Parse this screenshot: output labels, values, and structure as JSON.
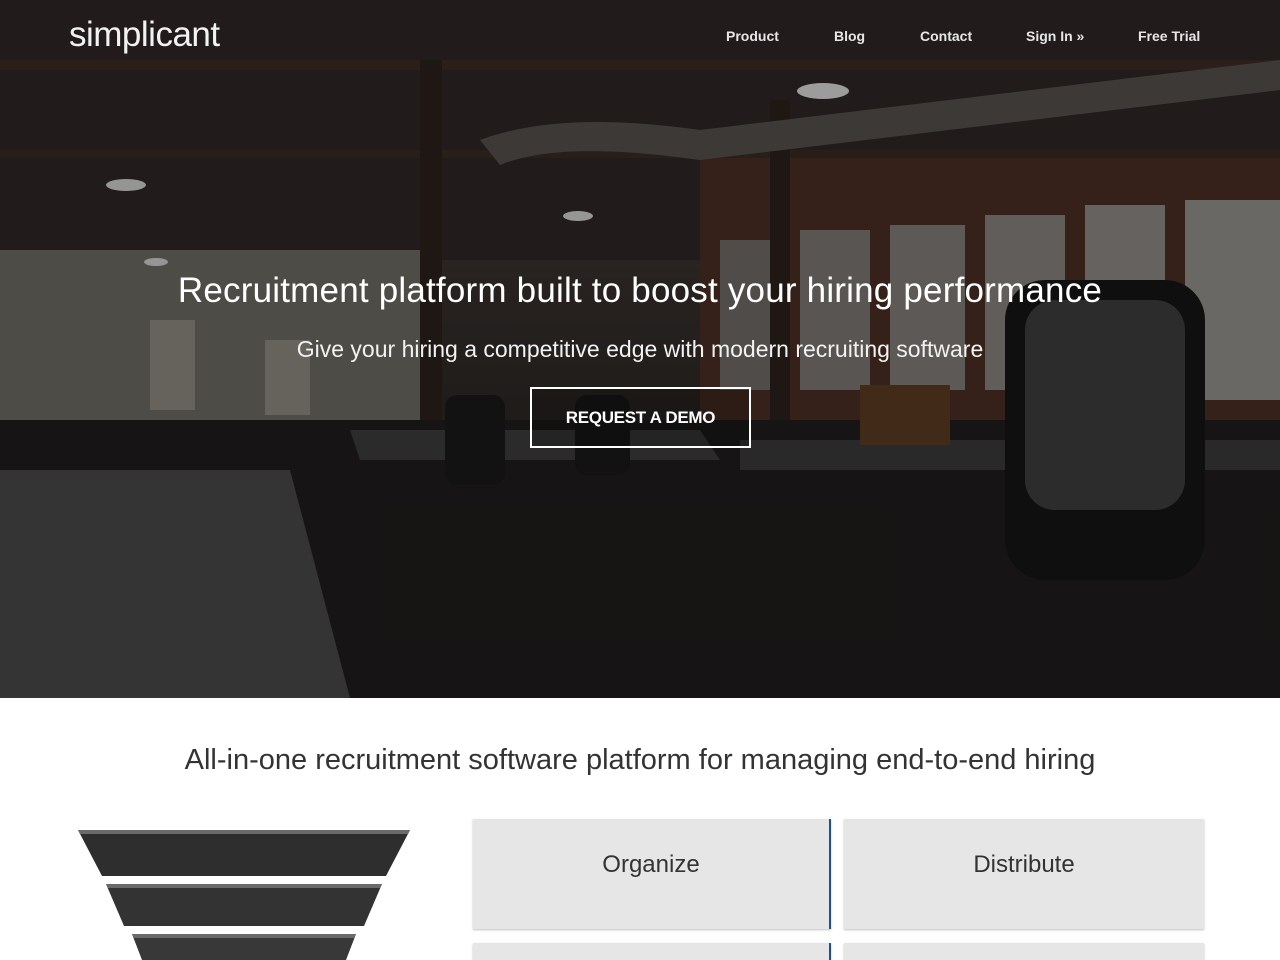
{
  "header": {
    "logo": "simplicant",
    "nav": {
      "product": "Product",
      "blog": "Blog",
      "contact": "Contact",
      "signin": "Sign In »",
      "trial": "Free Trial"
    }
  },
  "hero": {
    "title": "Recruitment platform built to boost your hiring performance",
    "subtitle": "Give your hiring a competitive edge with modern recruiting software",
    "cta": "REQUEST A DEMO"
  },
  "section": {
    "title": "All-in-one recruitment software platform for managing end-to-end hiring",
    "features": {
      "organize": "Organize",
      "distribute": "Distribute"
    }
  },
  "colors": {
    "accent_border": "#1f4f8f",
    "card_bg": "#e6e6e6",
    "text_dark": "#333333"
  }
}
